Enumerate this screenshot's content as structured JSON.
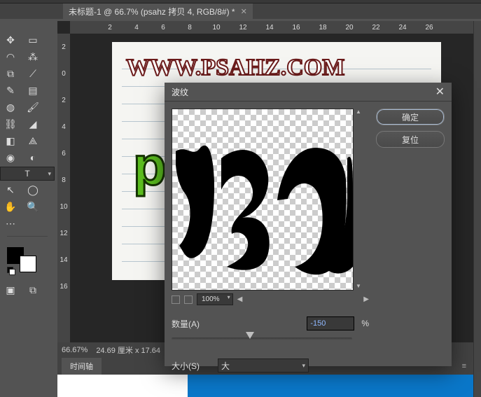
{
  "tab": {
    "title": "未标题-1 @ 66.7% (psahz 拷贝 4, RGB/8#) *",
    "close": "✕"
  },
  "ruler_h": [
    "",
    "2",
    "4",
    "6",
    "8",
    "10",
    "12",
    "14",
    "16",
    "18",
    "20",
    "22",
    "24",
    "26"
  ],
  "ruler_v": [
    "2",
    "0",
    "2",
    "4",
    "6",
    "8",
    "10",
    "12",
    "14",
    "16"
  ],
  "canvas": {
    "url": "WWW.PSAHZ.COM",
    "green": "p"
  },
  "status": {
    "zoom": "66.67%",
    "dims": "24.69 厘米 x 17.64"
  },
  "timeline": {
    "label": "时间轴"
  },
  "dialog": {
    "title": "波纹",
    "close": "✕",
    "ok": "确定",
    "reset": "复位",
    "zoom": "100%",
    "amount_label": "数量(A)",
    "amount_value": "-150",
    "amount_unit": "%",
    "size_label": "大小(S)",
    "size_value": "大",
    "nav_prev": "◀",
    "nav_next": "▶",
    "arrow_up": "▲",
    "arrow_down": "▼"
  },
  "swatch": {
    "mode": "q"
  }
}
